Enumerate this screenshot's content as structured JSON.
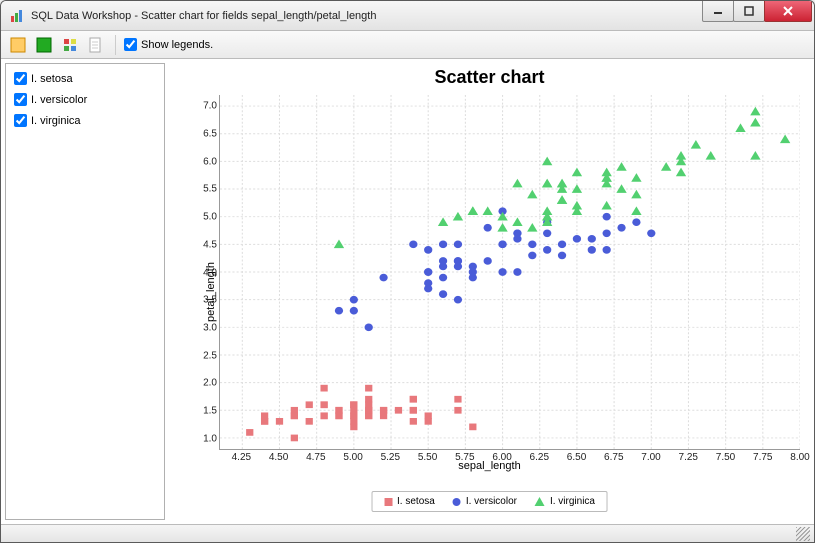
{
  "window": {
    "title": "SQL Data Workshop - Scatter chart for fields sepal_length/petal_length"
  },
  "toolbar": {
    "show_legends_label": "Show legends."
  },
  "sidebar": {
    "items": [
      {
        "label": "I. setosa",
        "checked": true
      },
      {
        "label": "I. versicolor",
        "checked": true
      },
      {
        "label": "I. virginica",
        "checked": true
      }
    ]
  },
  "chart": {
    "title": "Scatter chart",
    "xlabel": "sepal_length",
    "ylabel": "petal_length"
  },
  "legend": {
    "items": [
      {
        "label": "I. setosa"
      },
      {
        "label": "I. versicolor"
      },
      {
        "label": "I. virginica"
      }
    ]
  },
  "chart_data": {
    "type": "scatter",
    "title": "Scatter chart",
    "xlabel": "sepal_length",
    "ylabel": "petal_length",
    "xlim": [
      4.1,
      8.0
    ],
    "ylim": [
      0.8,
      7.2
    ],
    "xticks": [
      4.25,
      4.5,
      4.75,
      5.0,
      5.25,
      5.5,
      5.75,
      6.0,
      6.25,
      6.5,
      6.75,
      7.0,
      7.25,
      7.5,
      7.75,
      8.0
    ],
    "yticks": [
      1.0,
      1.5,
      2.0,
      2.5,
      3.0,
      3.5,
      4.0,
      4.5,
      5.0,
      5.5,
      6.0,
      6.5,
      7.0
    ],
    "grid": true,
    "legend_position": "bottom",
    "series": [
      {
        "name": "I. setosa",
        "marker": "square",
        "color": "#e8787c",
        "points": [
          [
            5.1,
            1.4
          ],
          [
            4.9,
            1.4
          ],
          [
            4.7,
            1.3
          ],
          [
            4.6,
            1.5
          ],
          [
            5.0,
            1.4
          ],
          [
            5.4,
            1.7
          ],
          [
            4.6,
            1.4
          ],
          [
            5.0,
            1.5
          ],
          [
            4.4,
            1.4
          ],
          [
            4.9,
            1.5
          ],
          [
            5.4,
            1.5
          ],
          [
            4.8,
            1.6
          ],
          [
            4.8,
            1.4
          ],
          [
            4.3,
            1.1
          ],
          [
            5.8,
            1.2
          ],
          [
            5.7,
            1.5
          ],
          [
            5.4,
            1.3
          ],
          [
            5.1,
            1.4
          ],
          [
            5.7,
            1.7
          ],
          [
            5.1,
            1.5
          ],
          [
            5.4,
            1.7
          ],
          [
            5.1,
            1.5
          ],
          [
            4.6,
            1.0
          ],
          [
            5.1,
            1.7
          ],
          [
            4.8,
            1.9
          ],
          [
            5.0,
            1.6
          ],
          [
            5.0,
            1.6
          ],
          [
            5.2,
            1.5
          ],
          [
            5.2,
            1.4
          ],
          [
            4.7,
            1.6
          ],
          [
            4.8,
            1.6
          ],
          [
            5.4,
            1.5
          ],
          [
            5.2,
            1.5
          ],
          [
            5.5,
            1.4
          ],
          [
            4.9,
            1.5
          ],
          [
            5.0,
            1.2
          ],
          [
            5.5,
            1.3
          ],
          [
            4.9,
            1.4
          ],
          [
            4.4,
            1.3
          ],
          [
            5.1,
            1.5
          ],
          [
            5.0,
            1.3
          ],
          [
            4.5,
            1.3
          ],
          [
            4.4,
            1.3
          ],
          [
            5.0,
            1.6
          ],
          [
            5.1,
            1.9
          ],
          [
            4.8,
            1.4
          ],
          [
            5.1,
            1.6
          ],
          [
            4.6,
            1.4
          ],
          [
            5.3,
            1.5
          ],
          [
            5.0,
            1.4
          ]
        ]
      },
      {
        "name": "I. versicolor",
        "marker": "circle",
        "color": "#4a5cd8",
        "points": [
          [
            7.0,
            4.7
          ],
          [
            6.4,
            4.5
          ],
          [
            6.9,
            4.9
          ],
          [
            5.5,
            4.0
          ],
          [
            6.5,
            4.6
          ],
          [
            5.7,
            4.5
          ],
          [
            6.3,
            4.7
          ],
          [
            4.9,
            3.3
          ],
          [
            6.6,
            4.6
          ],
          [
            5.2,
            3.9
          ],
          [
            5.0,
            3.5
          ],
          [
            5.9,
            4.2
          ],
          [
            6.0,
            4.0
          ],
          [
            6.1,
            4.7
          ],
          [
            5.6,
            3.6
          ],
          [
            6.7,
            4.4
          ],
          [
            5.6,
            4.5
          ],
          [
            5.8,
            4.1
          ],
          [
            6.2,
            4.5
          ],
          [
            5.6,
            3.9
          ],
          [
            5.9,
            4.8
          ],
          [
            6.1,
            4.0
          ],
          [
            6.3,
            4.9
          ],
          [
            6.1,
            4.7
          ],
          [
            6.4,
            4.3
          ],
          [
            6.6,
            4.4
          ],
          [
            6.8,
            4.8
          ],
          [
            6.7,
            5.0
          ],
          [
            6.0,
            4.5
          ],
          [
            5.7,
            3.5
          ],
          [
            5.5,
            3.8
          ],
          [
            5.5,
            3.7
          ],
          [
            5.8,
            3.9
          ],
          [
            6.0,
            5.1
          ],
          [
            5.4,
            4.5
          ],
          [
            6.0,
            4.5
          ],
          [
            6.7,
            4.7
          ],
          [
            6.3,
            4.4
          ],
          [
            5.6,
            4.1
          ],
          [
            5.5,
            4.0
          ],
          [
            5.5,
            4.4
          ],
          [
            6.1,
            4.6
          ],
          [
            5.8,
            4.0
          ],
          [
            5.0,
            3.3
          ],
          [
            5.6,
            4.2
          ],
          [
            5.7,
            4.2
          ],
          [
            5.7,
            4.2
          ],
          [
            6.2,
            4.3
          ],
          [
            5.1,
            3.0
          ],
          [
            5.7,
            4.1
          ]
        ]
      },
      {
        "name": "I. virginica",
        "marker": "triangle",
        "color": "#52d070",
        "points": [
          [
            6.3,
            6.0
          ],
          [
            5.8,
            5.1
          ],
          [
            7.1,
            5.9
          ],
          [
            6.3,
            5.6
          ],
          [
            6.5,
            5.8
          ],
          [
            7.6,
            6.6
          ],
          [
            4.9,
            4.5
          ],
          [
            7.3,
            6.3
          ],
          [
            6.7,
            5.8
          ],
          [
            7.2,
            6.1
          ],
          [
            6.5,
            5.1
          ],
          [
            6.4,
            5.3
          ],
          [
            6.8,
            5.5
          ],
          [
            5.7,
            5.0
          ],
          [
            5.8,
            5.1
          ],
          [
            6.4,
            5.3
          ],
          [
            6.5,
            5.5
          ],
          [
            7.7,
            6.7
          ],
          [
            7.7,
            6.9
          ],
          [
            6.0,
            5.0
          ],
          [
            6.9,
            5.7
          ],
          [
            5.6,
            4.9
          ],
          [
            7.7,
            6.7
          ],
          [
            6.3,
            4.9
          ],
          [
            6.7,
            5.7
          ],
          [
            7.2,
            6.0
          ],
          [
            6.2,
            4.8
          ],
          [
            6.1,
            4.9
          ],
          [
            6.4,
            5.6
          ],
          [
            7.2,
            5.8
          ],
          [
            7.4,
            6.1
          ],
          [
            7.9,
            6.4
          ],
          [
            6.4,
            5.6
          ],
          [
            6.3,
            5.1
          ],
          [
            6.1,
            5.6
          ],
          [
            7.7,
            6.1
          ],
          [
            6.3,
            5.6
          ],
          [
            6.4,
            5.5
          ],
          [
            6.0,
            4.8
          ],
          [
            6.9,
            5.4
          ],
          [
            6.7,
            5.6
          ],
          [
            6.9,
            5.1
          ],
          [
            5.8,
            5.1
          ],
          [
            6.8,
            5.9
          ],
          [
            6.7,
            5.7
          ],
          [
            6.7,
            5.2
          ],
          [
            6.3,
            5.0
          ],
          [
            6.5,
            5.2
          ],
          [
            6.2,
            5.4
          ],
          [
            5.9,
            5.1
          ]
        ]
      }
    ]
  }
}
